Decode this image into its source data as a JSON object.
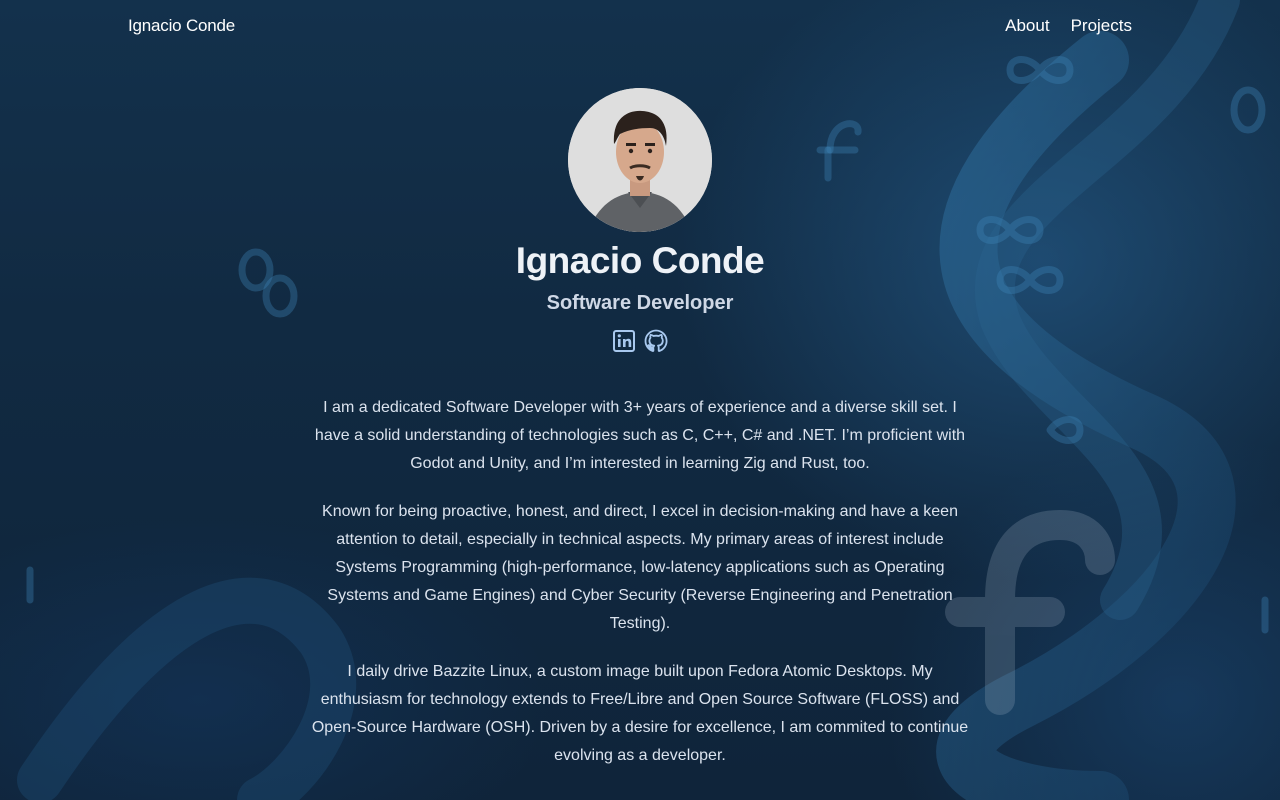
{
  "nav": {
    "brand": "Ignacio Conde",
    "links": [
      {
        "label": "About"
      },
      {
        "label": "Projects"
      }
    ]
  },
  "profile": {
    "name": "Ignacio Conde",
    "role": "Software Developer",
    "socials": [
      {
        "icon": "linkedin-icon"
      },
      {
        "icon": "github-icon"
      }
    ]
  },
  "bio": {
    "paragraphs": [
      "I am a dedicated Software Developer with 3+ years of experience and a diverse skill set. I have a solid understanding of technologies such as C, C++, C# and .NET. I’m proficient with Godot and Unity, and I’m interested in learning Zig and Rust, too.",
      "Known for being proactive, honest, and direct, I excel in decision-making and have a keen attention to detail, especially in technical aspects. My primary areas of interest include Systems Programming (high-performance, low-latency applications such as Operating Systems and Game Engines) and Cyber Security (Reverse Engineering and Penetration Testing).",
      "I daily drive Bazzite Linux, a custom image built upon Fedora Atomic Desktops. My enthusiasm for technology extends to Free/Libre and Open Source Software (FLOSS) and Open-Source Hardware (OSH). Driven by a desire for excellence, I am commited to continue evolving as a developer."
    ]
  },
  "colors": {
    "background": "#112a42",
    "text": "#e8edf3",
    "link": "#6fa8ff"
  }
}
